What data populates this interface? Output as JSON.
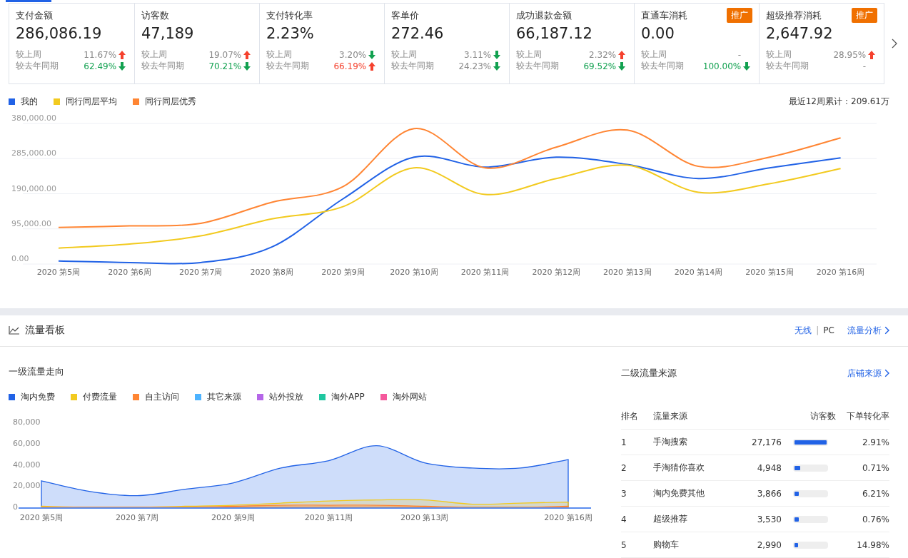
{
  "metrics": [
    {
      "title": "支付金额",
      "value": "286,086.19",
      "comparisons": [
        {
          "label": "较上周",
          "value": "11.67%",
          "kind": "up",
          "highlight": false
        },
        {
          "label": "较去年同期",
          "value": "62.49%",
          "kind": "down",
          "highlight": true
        }
      ]
    },
    {
      "title": "访客数",
      "value": "47,189",
      "comparisons": [
        {
          "label": "较上周",
          "value": "19.07%",
          "kind": "up",
          "highlight": false
        },
        {
          "label": "较去年同期",
          "value": "70.21%",
          "kind": "down",
          "highlight": true
        }
      ]
    },
    {
      "title": "支付转化率",
      "value": "2.23%",
      "comparisons": [
        {
          "label": "较上周",
          "value": "3.20%",
          "kind": "down",
          "highlight": false
        },
        {
          "label": "较去年同期",
          "value": "66.19%",
          "kind": "up",
          "highlight": true
        }
      ]
    },
    {
      "title": "客单价",
      "value": "272.46",
      "comparisons": [
        {
          "label": "较上周",
          "value": "3.11%",
          "kind": "down",
          "highlight": false
        },
        {
          "label": "较去年同期",
          "value": "24.23%",
          "kind": "down",
          "highlight": false
        }
      ]
    },
    {
      "title": "成功退款金额",
      "value": "66,187.12",
      "comparisons": [
        {
          "label": "较上周",
          "value": "2.32%",
          "kind": "up",
          "highlight": false
        },
        {
          "label": "较去年同期",
          "value": "69.52%",
          "kind": "down",
          "highlight": true
        }
      ]
    },
    {
      "title": "直通车消耗",
      "value": "0.00",
      "badge": "推广",
      "comparisons": [
        {
          "label": "较上周",
          "value": "-",
          "kind": "none"
        },
        {
          "label": "较去年同期",
          "value": "100.00%",
          "kind": "down",
          "highlight": true
        }
      ]
    },
    {
      "title": "超级推荐消耗",
      "value": "2,647.92",
      "badge": "推广",
      "comparisons": [
        {
          "label": "较上周",
          "value": "28.95%",
          "kind": "up",
          "highlight": false
        },
        {
          "label": "较去年同期",
          "value": "-",
          "kind": "none"
        }
      ]
    }
  ],
  "trend": {
    "total": "最近12周累计：209.61万",
    "chart_data": {
      "type": "line",
      "categories": [
        "2020 第5周",
        "2020 第6周",
        "2020 第7周",
        "2020 第8周",
        "2020 第9周",
        "2020 第10周",
        "2020 第11周",
        "2020 第12周",
        "2020 第13周",
        "2020 第14周",
        "2020 第15周",
        "2020 第16周"
      ],
      "series": [
        {
          "name": "我的",
          "color": "#2162e6",
          "values": [
            8000,
            4000,
            4000,
            46000,
            176000,
            289000,
            262000,
            289000,
            269000,
            231000,
            260000,
            287000
          ]
        },
        {
          "name": "同行同层平均",
          "color": "#f2ca1f",
          "values": [
            43000,
            54000,
            76000,
            122000,
            155000,
            260000,
            188000,
            231000,
            267000,
            194000,
            217000,
            258000
          ]
        },
        {
          "name": "同行同层优秀",
          "color": "#ff8533",
          "values": [
            99000,
            103000,
            110000,
            167000,
            209000,
            366000,
            260000,
            316000,
            362000,
            264000,
            289000,
            341000
          ]
        }
      ],
      "ylim": [
        0,
        380000
      ],
      "grid": true,
      "legend": "top",
      "yticks": [
        {
          "value": 0,
          "label": "0.00"
        },
        {
          "value": 95000,
          "label": "95,000.00"
        },
        {
          "value": 190000,
          "label": "190,000.00"
        },
        {
          "value": 285000,
          "label": "285,000.00"
        },
        {
          "value": 380000,
          "label": "380,000.00"
        }
      ]
    }
  },
  "traffic": {
    "title": "流量看板",
    "views": [
      {
        "label": "无线",
        "selected": true
      },
      {
        "label": "PC",
        "selected": false
      }
    ],
    "separator": "|",
    "link": "流量分析",
    "primary": {
      "title": "一级流量走向",
      "chart_data": {
        "type": "area",
        "categories": [
          "2020 第5周",
          null,
          "2020 第7周",
          null,
          "2020 第9周",
          null,
          "2020 第11周",
          null,
          "2020 第13周",
          null,
          null,
          "2020 第16周"
        ],
        "ylim": [
          0,
          80000
        ],
        "yticks": [
          {
            "value": 0,
            "label": "0"
          },
          {
            "value": 20000,
            "label": "20,000"
          },
          {
            "value": 40000,
            "label": "40,000"
          },
          {
            "value": 60000,
            "label": "60,000"
          },
          {
            "value": 80000,
            "label": "80,000"
          }
        ],
        "series": [
          {
            "name": "淘内免费",
            "color": "#2162e6",
            "values": [
              25000,
              15000,
              11000,
              17000,
              23000,
              37000,
              44000,
              58000,
              42000,
              37000,
              37000,
              45000
            ]
          },
          {
            "name": "付费流量",
            "color": "#f2ca1f",
            "values": [
              1000,
              0,
              0,
              1000,
              2000,
              4000,
              6000,
              7000,
              7000,
              3000,
              4000,
              5000
            ]
          },
          {
            "name": "自主访问",
            "color": "#ff8533",
            "values": [
              0,
              0,
              0,
              0,
              1000,
              2000,
              2000,
              2000,
              1000,
              0,
              0,
              1000
            ]
          },
          {
            "name": "其它来源",
            "color": "#4db3ff",
            "values": [
              null,
              null,
              null,
              null,
              null,
              null,
              null,
              null,
              null,
              null,
              null,
              null
            ]
          },
          {
            "name": "站外投放",
            "color": "#b566e8",
            "values": [
              null,
              null,
              null,
              null,
              null,
              null,
              null,
              null,
              null,
              null,
              null,
              null
            ]
          },
          {
            "name": "淘外APP",
            "color": "#1fc7a0",
            "values": [
              null,
              null,
              null,
              null,
              null,
              null,
              null,
              null,
              null,
              null,
              null,
              null
            ]
          },
          {
            "name": "淘外网站",
            "color": "#f5599c",
            "values": [
              null,
              null,
              null,
              null,
              null,
              null,
              null,
              null,
              null,
              null,
              null,
              null
            ]
          }
        ],
        "legend": "top"
      }
    },
    "secondary": {
      "title": "二级流量来源",
      "link": "店铺来源",
      "columns": [
        "排名",
        "流量来源",
        "访客数",
        "下单转化率"
      ],
      "rows": [
        {
          "rank": "1",
          "source": "手淘搜索",
          "visitors": "27,176",
          "level": 1,
          "rate": "2.91%"
        },
        {
          "rank": "2",
          "source": "手淘猜你喜欢",
          "visitors": "4,948",
          "level": 0.18,
          "rate": "0.71%"
        },
        {
          "rank": "3",
          "source": "淘内免费其他",
          "visitors": "3,866",
          "level": 0.14,
          "rate": "6.21%"
        },
        {
          "rank": "4",
          "source": "超级推荐",
          "visitors": "3,530",
          "level": 0.13,
          "rate": "0.76%"
        },
        {
          "rank": "5",
          "source": "购物车",
          "visitors": "2,990",
          "level": 0.11,
          "rate": "14.98%"
        }
      ]
    }
  }
}
